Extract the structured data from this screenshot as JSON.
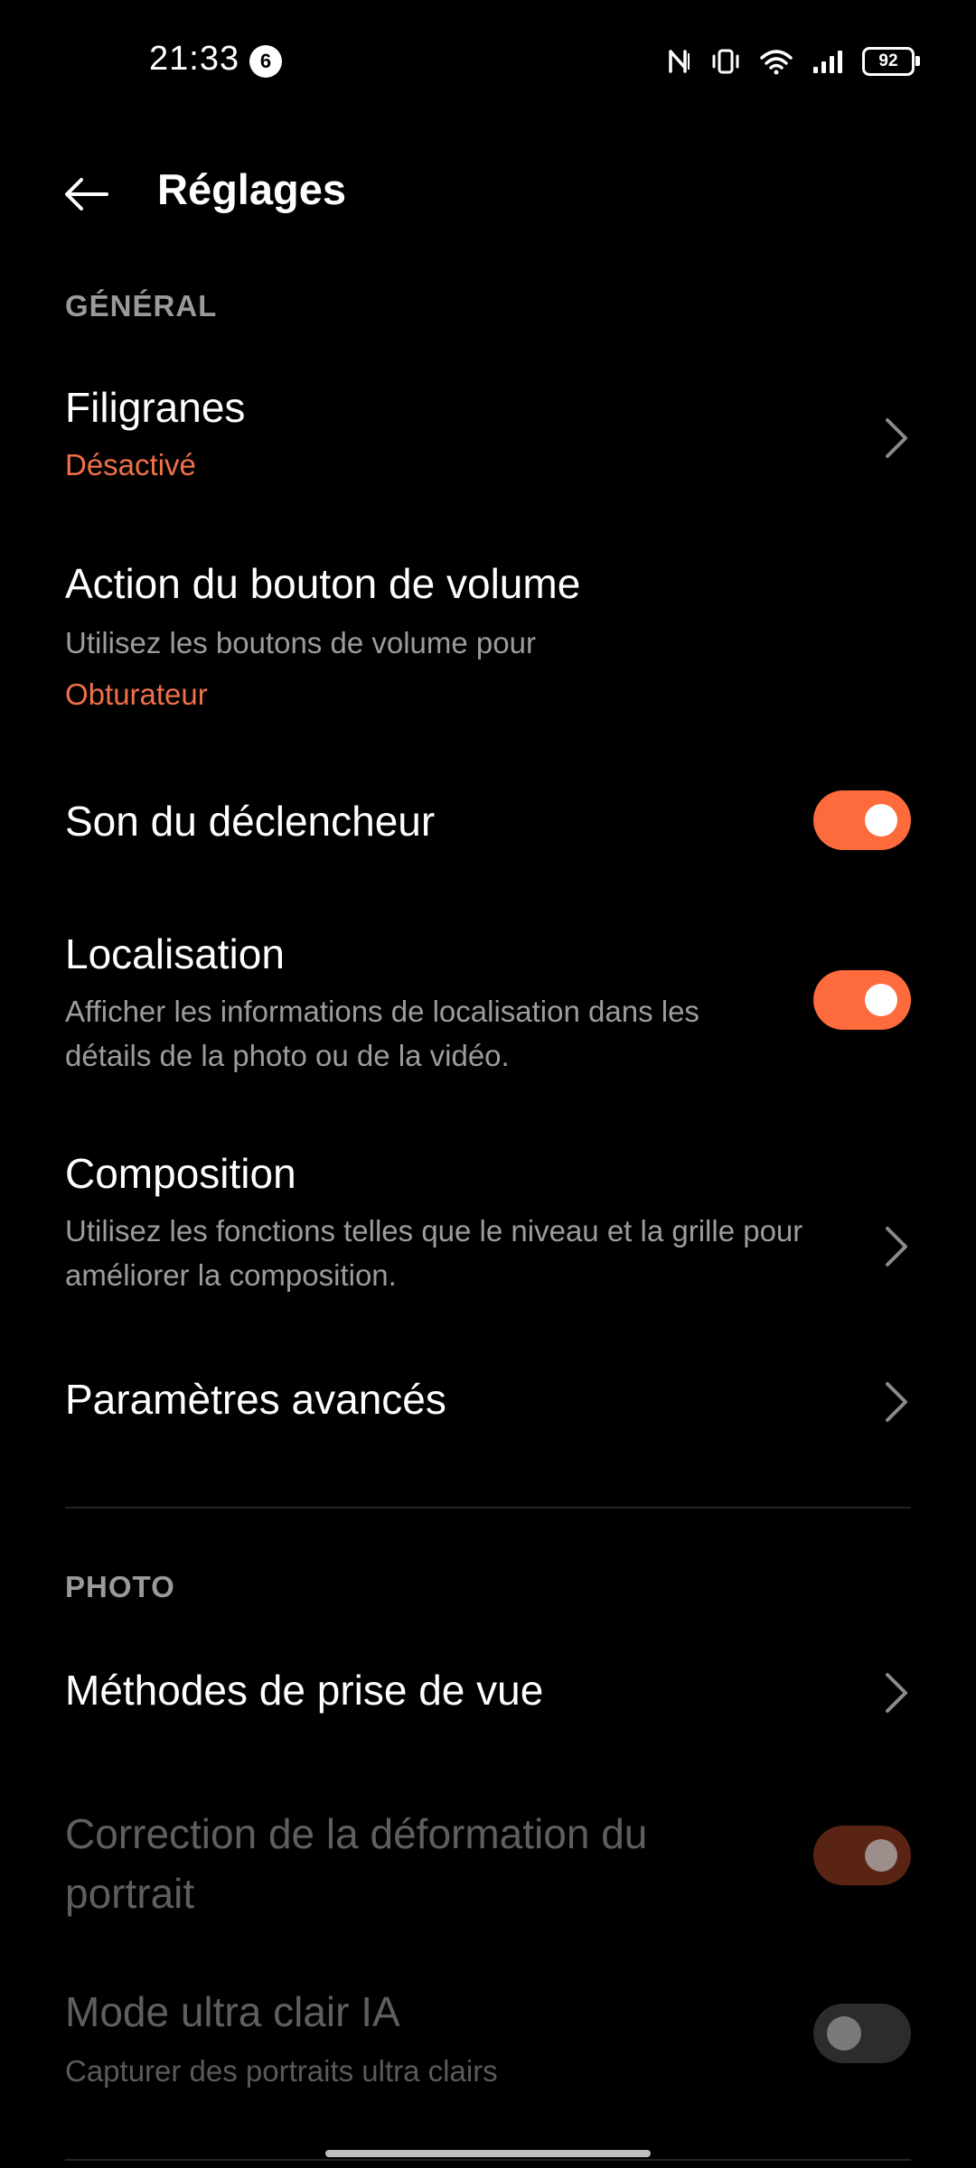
{
  "status_bar": {
    "time": "21:33",
    "notification_count": "6",
    "battery": "92"
  },
  "header": {
    "title": "Réglages",
    "back_icon": "arrow-left-icon"
  },
  "sections": {
    "general": "GÉNÉRAL",
    "photo": "PHOTO"
  },
  "settings": {
    "watermarks": {
      "title": "Filigranes",
      "value": "Désactivé"
    },
    "volume_action": {
      "title": "Action du bouton de volume",
      "subtitle": "Utilisez les boutons de volume pour",
      "value": "Obturateur"
    },
    "shutter_sound": {
      "title": "Son du déclencheur",
      "enabled": true
    },
    "location": {
      "title": "Localisation",
      "subtitle": "Afficher les informations de localisation dans les détails de la photo ou de la vidéo.",
      "enabled": true
    },
    "composition": {
      "title": "Composition",
      "subtitle": "Utilisez les fonctions telles que le niveau et la grille pour améliorer la composition."
    },
    "advanced": {
      "title": "Paramètres avancés"
    },
    "shooting_methods": {
      "title": "Méthodes de prise de vue"
    },
    "portrait_correction": {
      "title": "Correction de la déformation du portrait",
      "enabled": true,
      "disabled": true
    },
    "ai_ultra_clear": {
      "title": "Mode ultra clair IA",
      "subtitle": "Capturer des portraits ultra clairs",
      "enabled": false,
      "disabled": true
    }
  },
  "colors": {
    "accent": "#fd6a3c",
    "value_text": "#f0704a",
    "background": "#000000"
  }
}
